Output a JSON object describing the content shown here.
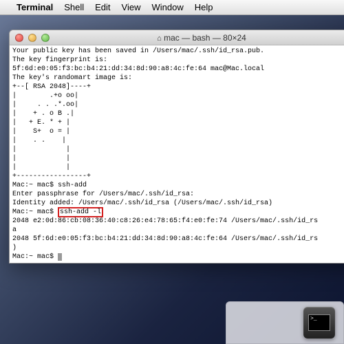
{
  "menubar": {
    "apple": "",
    "appname": "Terminal",
    "items": [
      "Shell",
      "Edit",
      "View",
      "Window",
      "Help"
    ]
  },
  "window": {
    "title": "mac — bash — 80×24"
  },
  "terminal": {
    "lines": [
      "Your public key has been saved in /Users/mac/.ssh/id_rsa.pub.",
      "The key fingerprint is:",
      "5f:6d:e0:05:f3:bc:b4:21:dd:34:8d:90:a8:4c:fe:64 mac@Mac.local",
      "The key's randomart image is:",
      "+--[ RSA 2048]----+",
      "|        .+o oo|",
      "|     . . .*.oo|",
      "|    + . o B .|",
      "|   + E. * + |",
      "|    S+  o = |",
      "|    . .    |",
      "|            |",
      "|            |",
      "|            |",
      "+-----------------+",
      "Mac:~ mac$ ssh-add",
      "Enter passphrase for /Users/mac/.ssh/id_rsa:",
      "Identity added: /Users/mac/.ssh/id_rsa (/Users/mac/.ssh/id_rsa)"
    ],
    "prompt2_left": "Mac:~ mac$ ",
    "highlight": "ssh-add -l",
    "lines2": [
      "2048 e2:0d:86:cb:08:36:40:c8:26:e4:78:65:f4:e0:fe:74 /Users/mac/.ssh/id_rs",
      "a",
      "2048 5f:6d:e0:05:f3:bc:b4:21:dd:34:8d:90:a8:4c:fe:64 /Users/mac/.ssh/id_rs",
      ")"
    ],
    "prompt3": "Mac:~ mac$ "
  },
  "dock": {
    "terminal_glyph": ">_"
  }
}
